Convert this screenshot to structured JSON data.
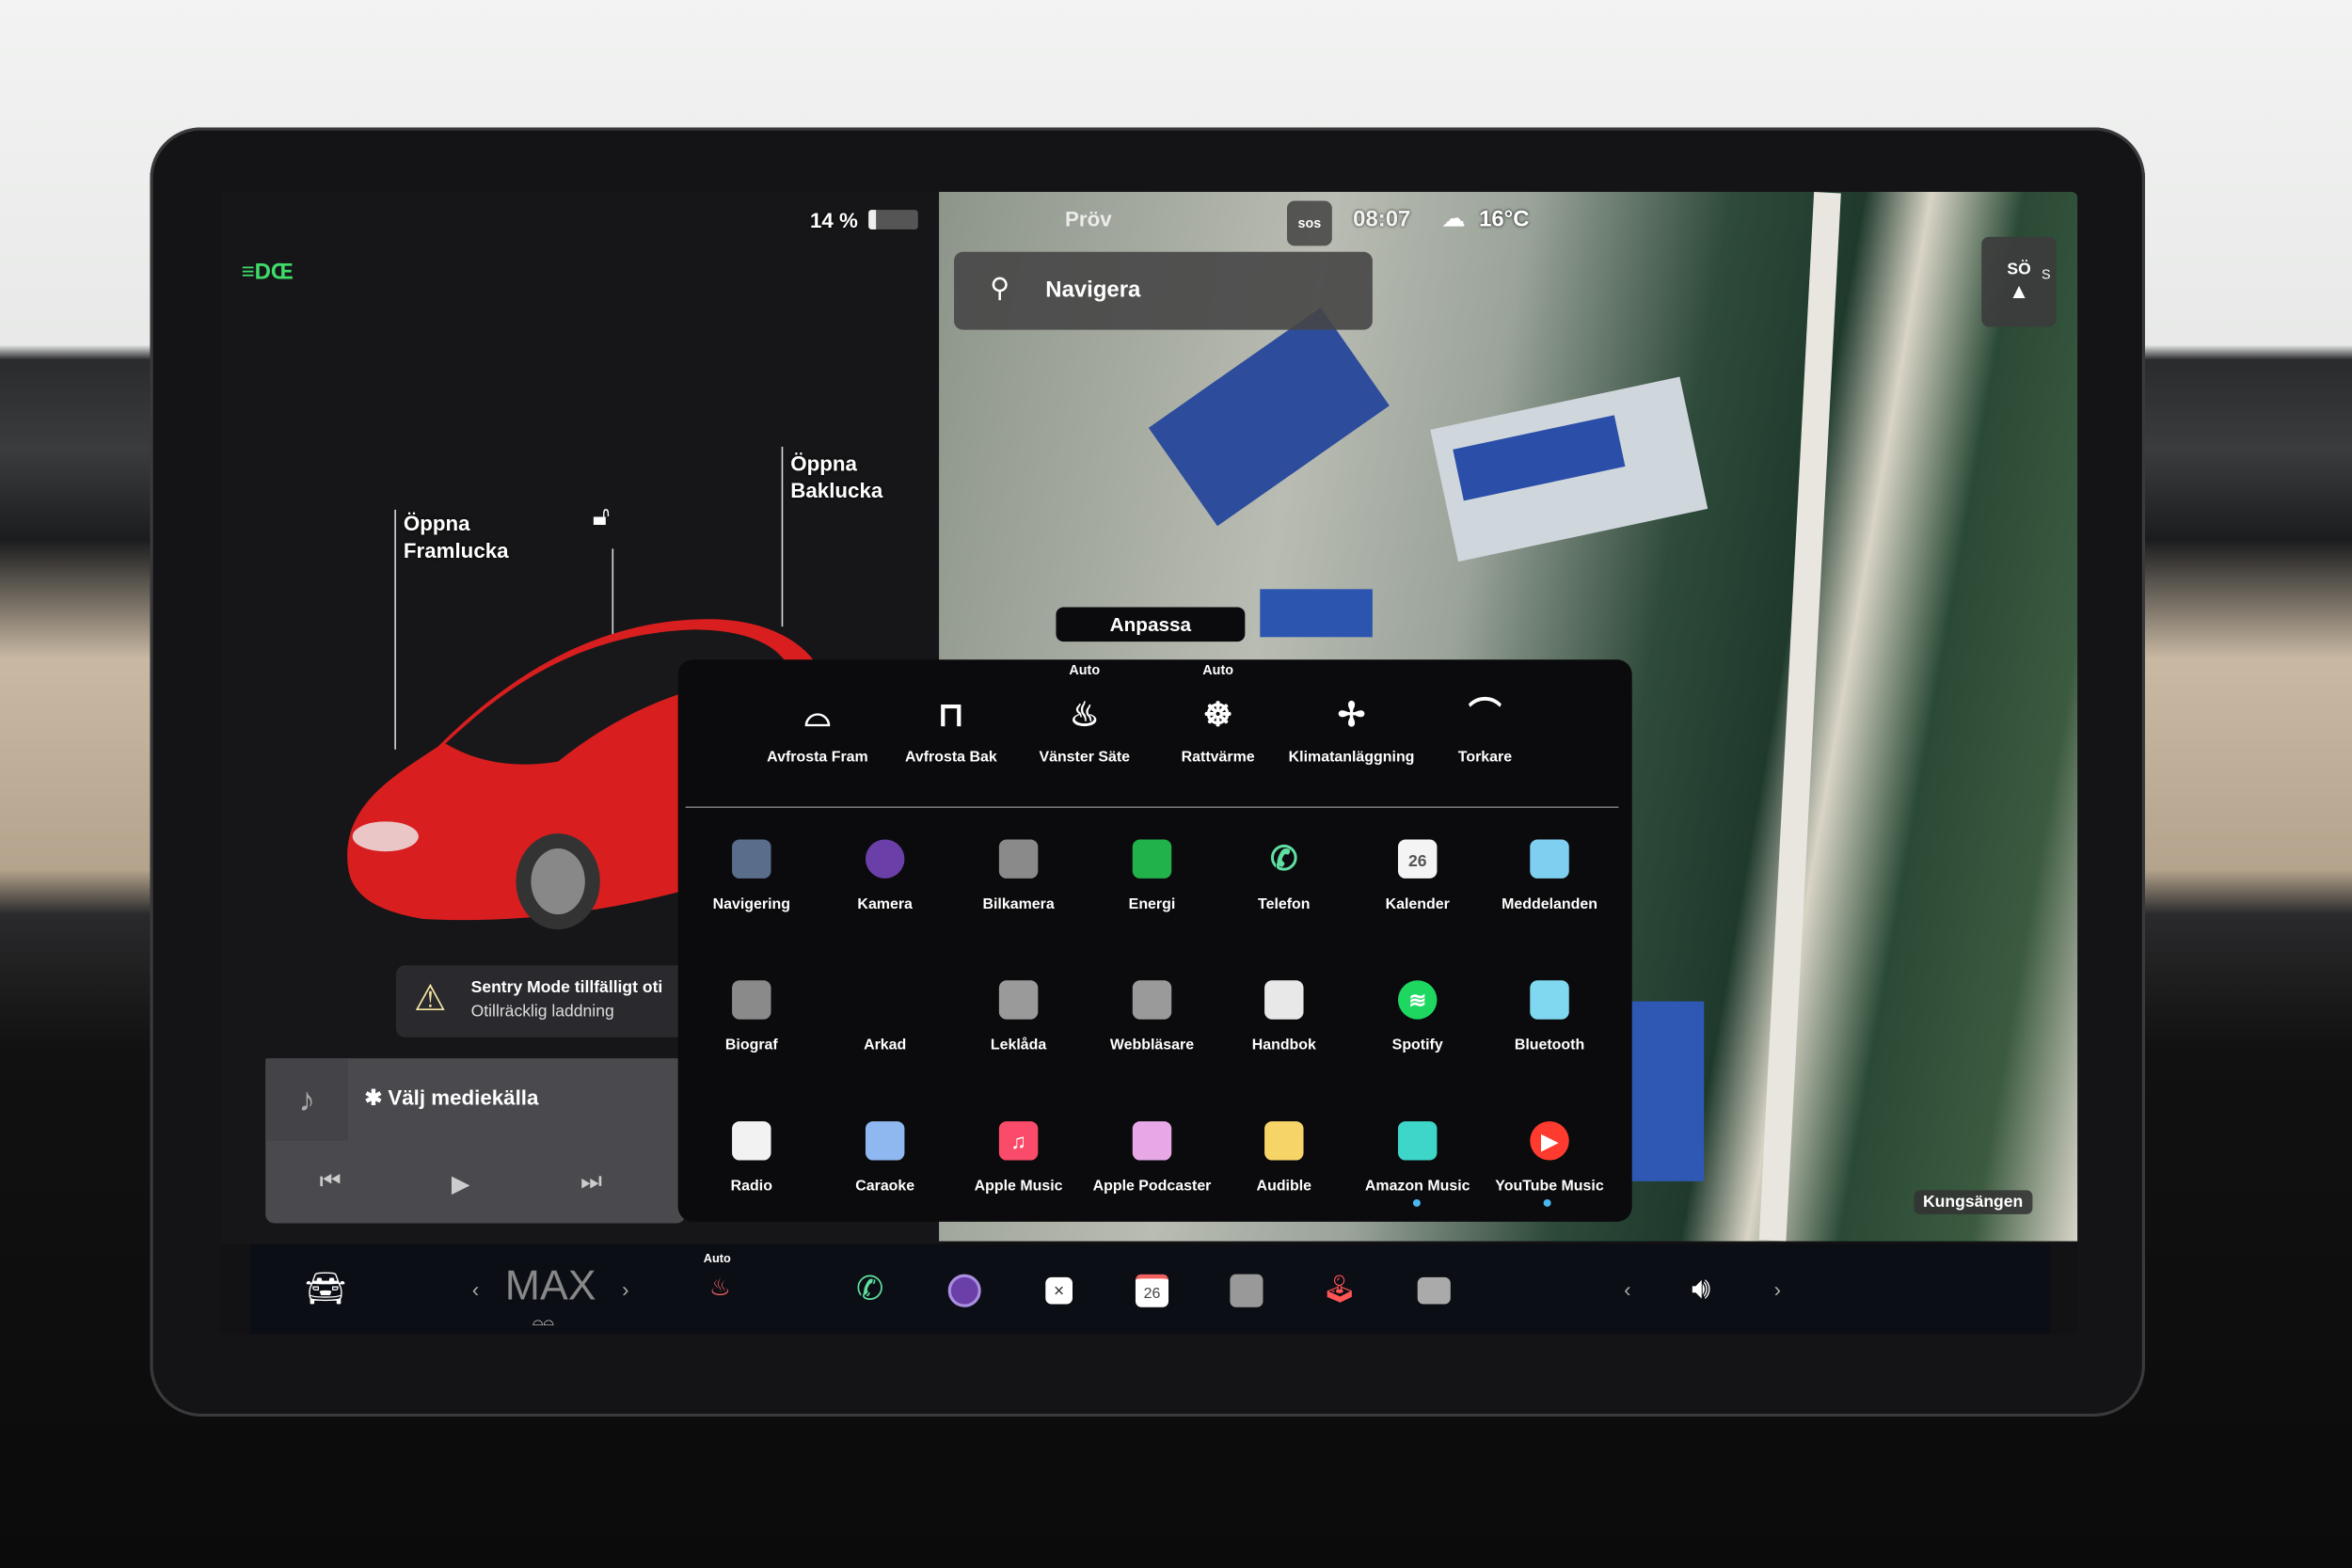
{
  "status": {
    "battery": "14 %",
    "battery_level_percent": 14,
    "profile": "Pröv",
    "time": "08:07",
    "sos": "sos",
    "temperature": "16°C"
  },
  "car": {
    "front_trunk": [
      "Öppna",
      "Framlucka"
    ],
    "rear_trunk": [
      "Öppna",
      "Baklucka"
    ]
  },
  "notification": {
    "title": "Sentry Mode tillfälligt oti",
    "subtitle": "Otillräcklig laddning"
  },
  "media": {
    "source": "Välj mediekälla"
  },
  "map": {
    "search_placeholder": "Navigera",
    "compass": "SÖ",
    "compass_s": "S",
    "location": "Kungsängen"
  },
  "launcher": {
    "customize": "Anpassa",
    "quick_controls": [
      {
        "label": "Avfrosta Fram",
        "icon": "front-defrost-icon",
        "badge": ""
      },
      {
        "label": "Avfrosta Bak",
        "icon": "rear-defrost-icon",
        "badge": ""
      },
      {
        "label": "Vänster Säte",
        "icon": "seat-heater-icon",
        "badge": "Auto"
      },
      {
        "label": "Rattvärme",
        "icon": "steering-wheel-heat-icon",
        "badge": "Auto"
      },
      {
        "label": "Klimatanläggning",
        "icon": "fan-icon",
        "badge": ""
      },
      {
        "label": "Torkare",
        "icon": "wiper-icon",
        "badge": ""
      }
    ],
    "apps": [
      {
        "label": "Navigering",
        "icon": "navigation-icon",
        "color": "#5a6e8c"
      },
      {
        "label": "Kamera",
        "icon": "camera-icon",
        "color": "#6b3fa8"
      },
      {
        "label": "Bilkamera",
        "icon": "dashcam-icon",
        "color": "#8a8a8a"
      },
      {
        "label": "Energi",
        "icon": "energy-icon",
        "color": "#22b24c"
      },
      {
        "label": "Telefon",
        "icon": "phone-icon",
        "color": "#0b0b0d"
      },
      {
        "label": "Kalender",
        "icon": "calendar-icon",
        "color": "#f4f4f4",
        "text": "26"
      },
      {
        "label": "Meddelanden",
        "icon": "messages-icon",
        "color": "#7fd0f0"
      },
      {
        "label": "Biograf",
        "icon": "theater-icon",
        "color": "#8a8a8a"
      },
      {
        "label": "Arkad",
        "icon": "arcade-icon",
        "color": "#0b0b0d"
      },
      {
        "label": "Leklåda",
        "icon": "toybox-icon",
        "color": "#9a9a9a"
      },
      {
        "label": "Webbläsare",
        "icon": "browser-icon",
        "color": "#9a9a9a"
      },
      {
        "label": "Handbok",
        "icon": "manual-icon",
        "color": "#e8e8e8"
      },
      {
        "label": "Spotify",
        "icon": "spotify-icon",
        "color": "#1ed760"
      },
      {
        "label": "Bluetooth",
        "icon": "bluetooth-icon",
        "color": "#7fd8f0"
      },
      {
        "label": "Radio",
        "icon": "radio-icon",
        "color": "#f2f2f2"
      },
      {
        "label": "Caraoke",
        "icon": "caraoke-icon",
        "color": "#8fb8f0"
      },
      {
        "label": "Apple Music",
        "icon": "apple-music-icon",
        "color": "#fa4b6a"
      },
      {
        "label": "Apple Podcaster",
        "icon": "podcasts-icon",
        "color": "#e8a8e8"
      },
      {
        "label": "Audible",
        "icon": "audible-icon",
        "color": "#f7d468"
      },
      {
        "label": "Amazon Music",
        "icon": "amazon-music-icon",
        "color": "#3dd6c8"
      },
      {
        "label": "YouTube Music",
        "icon": "youtube-music-icon",
        "color": "#ff3b2f"
      }
    ]
  },
  "bottom_bar": {
    "fan_level": "MAX",
    "seat_badge": "Auto",
    "calendar_day": "26"
  },
  "colors": {
    "headlight_green": "#3fdc6a",
    "warning_yellow": "#f3e3a2",
    "phone_green": "#5fe0a0"
  }
}
